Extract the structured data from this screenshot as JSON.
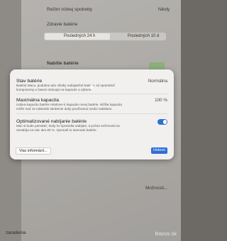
{
  "background": {
    "rows": [
      {
        "label": "Režim nízkej spotreby",
        "value": "Nikdy"
      },
      {
        "label": "Zdravie batérie",
        "value": ""
      },
      {
        "label": "Nabitie batérie",
        "value": ""
      }
    ],
    "segmented": [
      "Posledných 24 h",
      "Posledných 10 d"
    ],
    "sidebar_fragment": "zaradenia",
    "options_button": "Možnosti..."
  },
  "dialog": {
    "battery_state": {
      "title": "Stav batérie",
      "value": "Normálna",
      "description": "Batérie Macu, podobne ako všetky nabíjateľné batérie, sú spotrebné komponenty a časom strácajú na kapacite a výkone."
    },
    "max_capacity": {
      "title": "Maximálna kapacita",
      "value": "100 %",
      "description": "Udáva kapacitu batérie relatívne k kapacite novej batérie. Nižšia kapacita môže mať za následok skrátenie doby používania medzi nabitiami."
    },
    "optimized_charging": {
      "title": "Optimalizované nabíjanie batérie",
      "enabled": true,
      "description": "Mac si bude pamätať, kedy ho spravidla nabíjate, a počas nečinnosti sa nenabíja na viac ako 80 %. Spomalí to starnutie batérie."
    },
    "more_info_button": "Viac informácií...",
    "done_button": "Hotovo"
  },
  "watermark": "Bazos.sk",
  "colors": {
    "accent": "#2f6fd6",
    "dialog_bg": "#f1f0ee"
  }
}
